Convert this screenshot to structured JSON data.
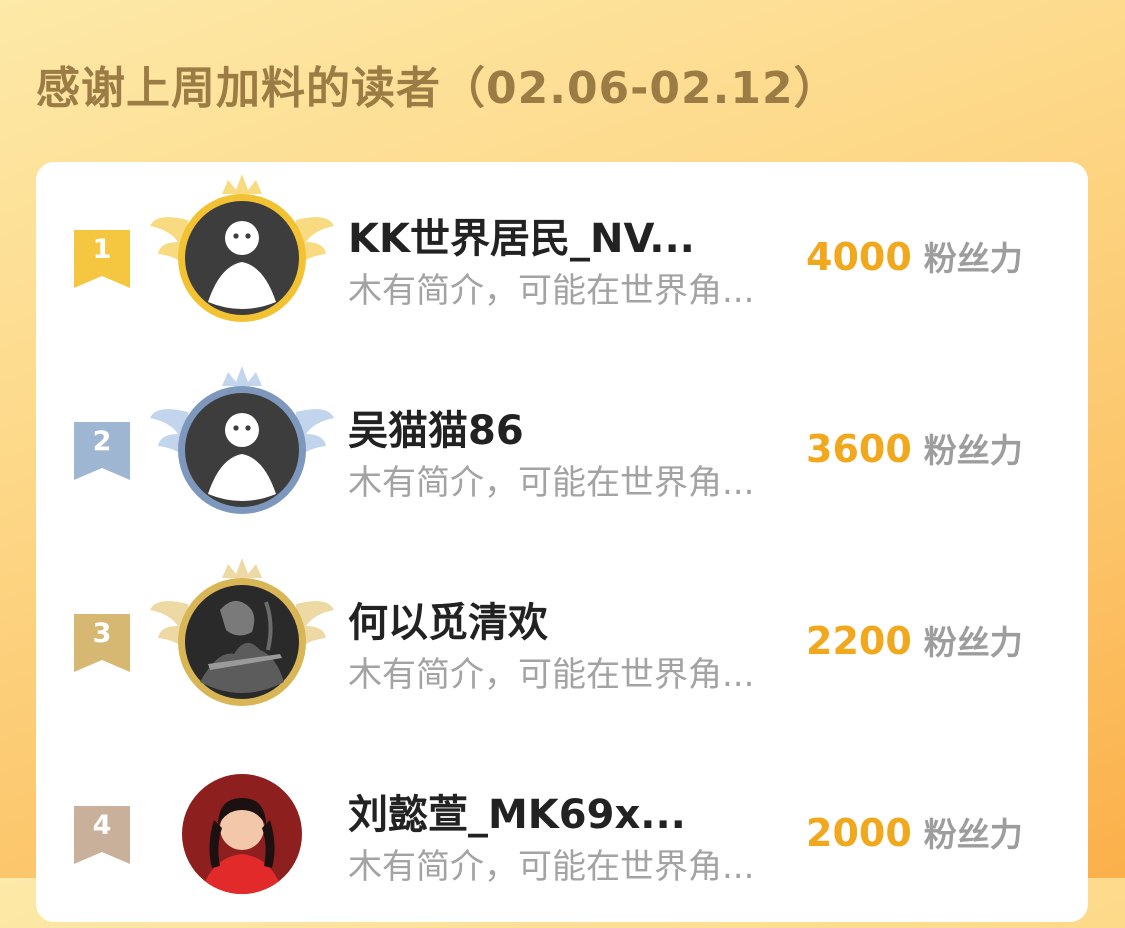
{
  "header": {
    "title": "感谢上周加料的读者（02.06-02.12）"
  },
  "leaderboard": {
    "items": [
      {
        "rank": "1",
        "name": "KK世界居民_NV...",
        "bio": "木有简介，可能在世界角...",
        "fans_value": "4000",
        "fans_label": "粉丝力",
        "avatar": "default-avatar-icon",
        "ribbon_color": "#f5c640",
        "ring_color": "#f3c232",
        "wing_color": "#f8d774"
      },
      {
        "rank": "2",
        "name": "吴猫猫86",
        "bio": "木有简介，可能在世界角...",
        "fans_value": "3600",
        "fans_label": "粉丝力",
        "avatar": "default-avatar-icon",
        "ribbon_color": "#9fb6d2",
        "ring_color": "#7e97bc",
        "wing_color": "#bcd1ec"
      },
      {
        "rank": "3",
        "name": "何以觅清欢",
        "bio": "木有简介，可能在世界角...",
        "fans_value": "2200",
        "fans_label": "粉丝力",
        "avatar": "photo-avatar-dark",
        "ribbon_color": "#d6b872",
        "ring_color": "#d8b555",
        "wing_color": "#ecd59a"
      },
      {
        "rank": "4",
        "name": "刘懿萱_MK69x...",
        "bio": "木有简介，可能在世界角...",
        "fans_value": "2000",
        "fans_label": "粉丝力",
        "avatar": "photo-avatar-red",
        "ribbon_color": "#c9b09a",
        "ring_color": "",
        "wing_color": ""
      }
    ]
  }
}
